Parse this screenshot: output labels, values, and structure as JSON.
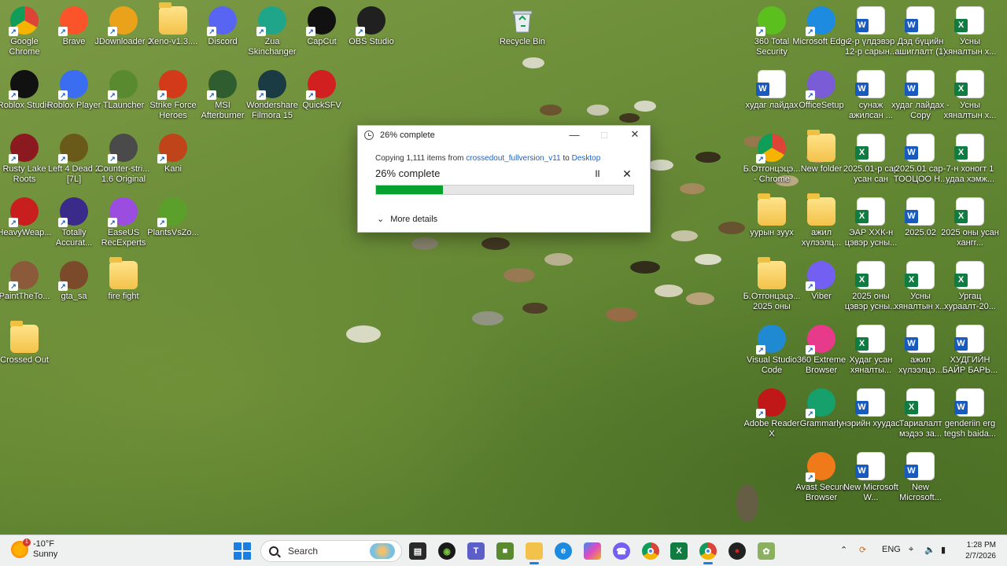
{
  "desktop": {
    "left_icons": [
      {
        "label": "Google Chrome",
        "icon": "chrome-icon",
        "color": "#ffffff"
      },
      {
        "label": "Brave",
        "icon": "brave-icon",
        "color": "#fb542b"
      },
      {
        "label": "JDownloader 2",
        "icon": "jdownloader-icon",
        "color": "#e9a21a"
      },
      {
        "label": "Xeno-v1.3....",
        "icon": "folder-icon",
        "color": "#f3c24a"
      },
      {
        "label": "Discord",
        "icon": "discord-icon",
        "color": "#5865f2"
      },
      {
        "label": "Zua Skinchanger",
        "icon": "zua-icon",
        "color": "#1fa58a"
      },
      {
        "label": "CapCut",
        "icon": "capcut-icon",
        "color": "#111111"
      },
      {
        "label": "OBS Studio",
        "icon": "obs-icon",
        "color": "#202020"
      },
      {
        "label": "Roblox Studio",
        "icon": "roblox-studio-icon",
        "color": "#111111"
      },
      {
        "label": "Roblox Player",
        "icon": "roblox-player-icon",
        "color": "#3b6df0"
      },
      {
        "label": "TLauncher",
        "icon": "tlauncher-icon",
        "color": "#5a8a2f"
      },
      {
        "label": "Strike Force Heroes",
        "icon": "strike-force-icon",
        "color": "#d23a1a"
      },
      {
        "label": "MSI Afterburner",
        "icon": "msi-afterburner-icon",
        "color": "#2f5d2f"
      },
      {
        "label": "Wondershare Filmora 15",
        "icon": "filmora-icon",
        "color": "#1b3b44"
      },
      {
        "label": "QuickSFV",
        "icon": "quicksfv-icon",
        "color": "#d22020"
      },
      {
        "label": "Rusty Lake Roots",
        "icon": "rusty-lake-icon",
        "color": "#8a1a20"
      },
      {
        "label": "Left 4 Dead 2 [7L]",
        "icon": "left4dead-icon",
        "color": "#6a5a1a"
      },
      {
        "label": "Counter-stri... 1.6 Original",
        "icon": "counter-strike-icon",
        "color": "#4a4a4a"
      },
      {
        "label": "Kani",
        "icon": "kani-icon",
        "color": "#c0441a"
      },
      {
        "label": "HeavyWeap...",
        "icon": "heavyweapon-icon",
        "color": "#c81e1e"
      },
      {
        "label": "Totally Accurat...",
        "icon": "tabs-icon",
        "color": "#3a2a8a"
      },
      {
        "label": "EaseUS RecExperts",
        "icon": "easeus-icon",
        "color": "#9b4de0"
      },
      {
        "label": "PlantsVsZo...",
        "icon": "pvz-icon",
        "color": "#5aa02a"
      },
      {
        "label": "PaintTheTo...",
        "icon": "paintthetown-icon",
        "color": "#8a5a3a"
      },
      {
        "label": "gta_sa",
        "icon": "gta-icon",
        "color": "#7a4a2a"
      },
      {
        "label": "fire fight",
        "icon": "folder-icon",
        "color": "#f3c24a"
      },
      {
        "label": "Crossed Out",
        "icon": "crossed-out-icon",
        "color": "#f3c24a"
      }
    ],
    "recycle_bin": {
      "label": "Recycle Bin",
      "icon": "recycle-bin-icon"
    },
    "right_icons": [
      {
        "label": "360 Total Security",
        "icon": "360-total-security-icon",
        "type": "app",
        "color": "#5bbf1e"
      },
      {
        "label": "Microsoft Edge",
        "icon": "edge-icon",
        "type": "app",
        "color": "#1d8be0"
      },
      {
        "label": "2-р үлдэвэр 12-р сарын...",
        "icon": "word-doc-icon",
        "type": "word"
      },
      {
        "label": "Дэд бүцийн ашиглалт (1)",
        "icon": "word-doc-icon",
        "type": "word"
      },
      {
        "label": "Усны хяналтын х...",
        "icon": "excel-doc-icon",
        "type": "excel"
      },
      {
        "label": "худаг лайдах",
        "icon": "word-doc-icon",
        "type": "word"
      },
      {
        "label": "OfficeSetup",
        "icon": "office-icon",
        "type": "app",
        "color": "#7a5cd6"
      },
      {
        "label": "сунаж ажилсан ...",
        "icon": "word-doc-icon",
        "type": "word"
      },
      {
        "label": "худаг лайдах - Copy",
        "icon": "word-doc-icon",
        "type": "word"
      },
      {
        "label": "Усны хяналтын х...",
        "icon": "excel-doc-icon",
        "type": "excel"
      },
      {
        "label": "Б.Отгонцэцэ... - Chrome",
        "icon": "chrome-profile-icon",
        "type": "app",
        "color": "#ffffff"
      },
      {
        "label": "New folder",
        "icon": "folder-icon",
        "type": "folder"
      },
      {
        "label": "2025.01-р сар усан сан",
        "icon": "excel-doc-icon",
        "type": "excel"
      },
      {
        "label": "2025.01 сар- ТООЦОО Н...",
        "icon": "word-doc-icon",
        "type": "word"
      },
      {
        "label": "7-н хонoгт 1 удаа хэмж...",
        "icon": "excel-doc-icon",
        "type": "excel"
      },
      {
        "label": "уурын зуух",
        "icon": "folder-icon",
        "type": "folder"
      },
      {
        "label": "ажил хүлээлц...",
        "icon": "folder-icon",
        "type": "folder"
      },
      {
        "label": "ЭАР ХХК-н цэвэр усны...",
        "icon": "excel-doc-icon",
        "type": "excel"
      },
      {
        "label": "2025.02",
        "icon": "word-doc-icon",
        "type": "word"
      },
      {
        "label": "2025 оны усан хангr...",
        "icon": "excel-doc-icon",
        "type": "excel"
      },
      {
        "label": "Б.Отгонцэцэ... 2025 оны",
        "icon": "folder-icon",
        "type": "folder"
      },
      {
        "label": "Viber",
        "icon": "viber-icon",
        "type": "app",
        "color": "#7360f2"
      },
      {
        "label": "2025 оны цэвэр усны...",
        "icon": "excel-doc-icon",
        "type": "excel"
      },
      {
        "label": "Усны хяналтын х...",
        "icon": "excel-doc-icon",
        "type": "excel"
      },
      {
        "label": "Ургац хураалт-20...",
        "icon": "excel-doc-icon",
        "type": "excel"
      },
      {
        "label": "Visual Studio Code",
        "icon": "vscode-icon",
        "type": "app",
        "color": "#1f8ad2"
      },
      {
        "label": "360 Extreme Browser",
        "icon": "360-browser-icon",
        "type": "app",
        "color": "#e83a8a"
      },
      {
        "label": "Худаг усан хяналты...",
        "icon": "excel-doc-icon",
        "type": "excel"
      },
      {
        "label": "ажил хүлээлцэ...",
        "icon": "word-doc-icon",
        "type": "word"
      },
      {
        "label": "ХУДГИЙН БАЙР БАРЬ...",
        "icon": "word-doc-icon",
        "type": "word"
      },
      {
        "label": "Adobe Reader X",
        "icon": "adobe-reader-icon",
        "type": "app",
        "color": "#c01818"
      },
      {
        "label": "Grammarly",
        "icon": "grammarly-icon",
        "type": "app",
        "color": "#15a06c"
      },
      {
        "label": "нэрийн хуудас",
        "icon": "word-doc-icon",
        "type": "word"
      },
      {
        "label": "Тариалалт мэдээ за...",
        "icon": "excel-doc-icon",
        "type": "excel"
      },
      {
        "label": "genderiin erg tegsh baida...",
        "icon": "word-doc-icon",
        "type": "word"
      },
      {
        "label": "Avast Secure Browser",
        "icon": "avast-browser-icon",
        "type": "app",
        "color": "#f07a1a"
      },
      {
        "label": "New Microsoft W...",
        "icon": "word-doc-icon",
        "type": "word"
      },
      {
        "label": "New Microsoft...",
        "icon": "word-doc-icon",
        "type": "word"
      }
    ]
  },
  "dialog": {
    "title": "26% complete",
    "copy_prefix": "Copying 1,111 items from",
    "source": "crossedout_fullversion_v11",
    "to_word": "to",
    "destination": "Desktop",
    "status": "26% complete",
    "progress": 0.26,
    "more_details": "More details",
    "accent": "#06a12f"
  },
  "taskbar": {
    "weather_temp": "-10°F",
    "weather_cond": "Sunny",
    "weather_badge": "1",
    "search_placeholder": "Search",
    "apps": [
      "start-icon",
      "file-explorer-icon",
      "xbox-icon",
      "teams-icon",
      "minecraft-icon",
      "folder-icon",
      "edge-icon",
      "copilot-icon",
      "viber-icon",
      "chrome-icon",
      "excel-icon",
      "chrome-profile-icon",
      "game-icon",
      "plant-icon"
    ],
    "language": "ENG",
    "time": "1:28 PM",
    "date": "2/7/2026"
  }
}
